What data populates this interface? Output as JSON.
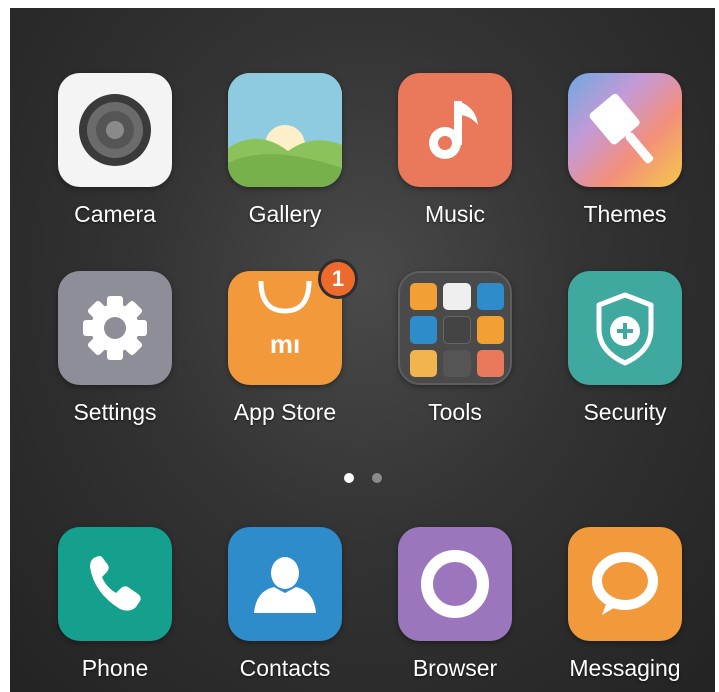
{
  "apps": {
    "camera": {
      "label": "Camera",
      "icon": "camera-icon",
      "color": "#f4f4f4"
    },
    "gallery": {
      "label": "Gallery",
      "icon": "gallery-icon",
      "color": "#8fcbe0"
    },
    "music": {
      "label": "Music",
      "icon": "music-note-icon",
      "color": "#e9795a"
    },
    "themes": {
      "label": "Themes",
      "icon": "paintbrush-icon",
      "color": "#f2b44c"
    },
    "settings": {
      "label": "Settings",
      "icon": "gear-icon",
      "color": "#8e8e99"
    },
    "appstore": {
      "label": "App Store",
      "icon": "mi-bag-icon",
      "color": "#f29a3b",
      "badge": "1"
    },
    "tools": {
      "label": "Tools",
      "icon": "folder-icon",
      "color": "#4a4a4a"
    },
    "security": {
      "label": "Security",
      "icon": "shield-plus-icon",
      "color": "#3fa9a0"
    }
  },
  "pager": {
    "active_color": "#ffffff",
    "inactive_color": "#8a8a8a",
    "pages": 2,
    "current": 1
  },
  "dock": {
    "phone": {
      "label": "Phone",
      "icon": "phone-icon",
      "color": "#15a08e"
    },
    "contacts": {
      "label": "Contacts",
      "icon": "person-icon",
      "color": "#2e8cca"
    },
    "browser": {
      "label": "Browser",
      "icon": "browser-icon",
      "color": "#9b76bd"
    },
    "messaging": {
      "label": "Messaging",
      "icon": "speech-bubble-icon",
      "color": "#f29a3b"
    }
  }
}
